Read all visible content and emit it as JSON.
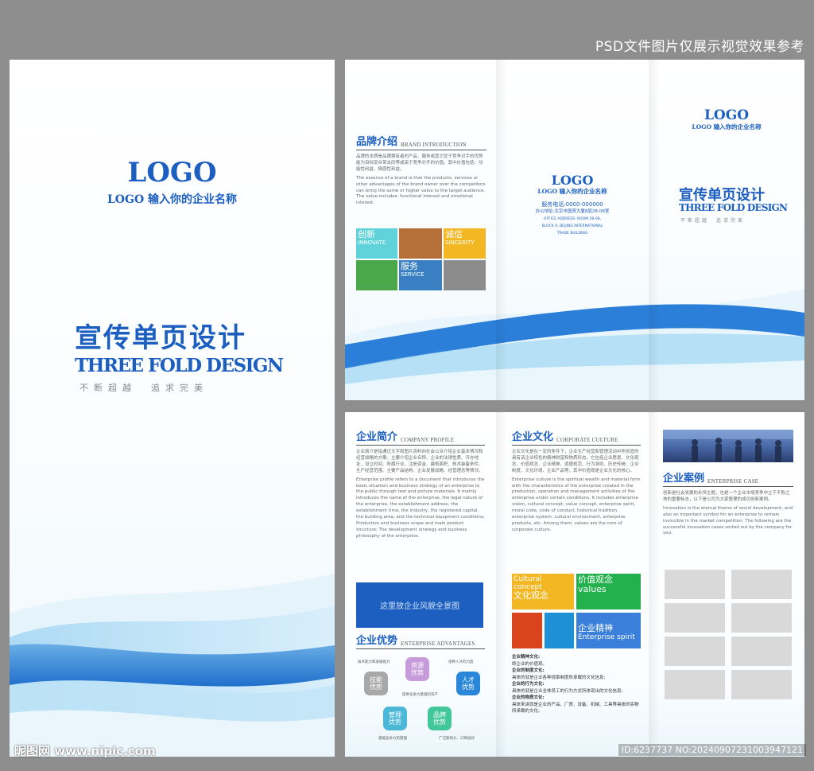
{
  "watermark_top": "PSD文件图片仅展示视觉效果参考",
  "watermark_bottom_left": "昵图网 www.nipic.com",
  "watermark_bottom_right": "ID:6237737 NO:20240907231003947121",
  "cover": {
    "logo": "LOGO",
    "company": "LOGO 输入你的企业名称",
    "title_cn": "宣传单页设计",
    "title_en": "THREE FOLD DESIGN",
    "slogan": "不断超越　追求完美"
  },
  "outside": {
    "brand": {
      "title_cn": "品牌介绍",
      "title_en": "BRAND INTRODUCTION",
      "text_cn": "品牌的本质是品牌拥有者的产品、服务或其它优于竞争对手的优势能为目标受众带去同等或高于竞争对手的价值。其中价值包括：功能性利益、情感性利益。",
      "text_en": "The essence of a brand is that the products, services or other advantages of the brand owner over the competitors can bring the same or higher value to the target audience. The value includes: functional interest and emotional interest.",
      "tiles": [
        {
          "cn": "创新",
          "en": "INNOVATE",
          "color": "#5fd3d9"
        },
        {
          "cn": "",
          "en": "",
          "color": "#b5703a"
        },
        {
          "cn": "诚信",
          "en": "SINCERITY",
          "color": "#f2b722"
        },
        {
          "cn": "",
          "en": "",
          "color": "#4aa84a"
        },
        {
          "cn": "服务",
          "en": "SERVICE",
          "color": "#3a7fc1"
        },
        {
          "cn": "",
          "en": "",
          "color": "#8c8c8c"
        }
      ]
    },
    "contact": {
      "logo": "LOGO",
      "company": "LOGO 输入你的企业名称",
      "phone": "服务电话:0000-000000",
      "address_cn": "办公地址:北京市国贸大厦8层28-08室",
      "address_en_1": "OFFICE ADDRESS: ROOM 28-08,",
      "address_en_2": "BLOCK A, BEIJING INTERNATIONAL",
      "address_en_3": "TRADE BUILDING"
    },
    "front": {
      "logo": "LOGO",
      "company": "LOGO 输入你的企业名称",
      "title_cn": "宣传单页设计",
      "title_en": "THREE FOLD DESIGN",
      "slogan": "不断超越　追求完美"
    }
  },
  "inside": {
    "profile": {
      "title_cn": "企业简介",
      "title_en": "COMPANY PROFILE",
      "text_cn": "企业简介是指通过文字和图片资料向社会公众介绍企业基本情况和经营战略的文案。主要介绍企业名称、企业的法律性质、开办地址、设立时间、所属行业、注册资金、建筑面积、技术装备条件、生产经营范围、主要产品结构、企业发展战略、经营理念等情况。",
      "text_en": "Enterprise profile refers to a document that introduces the basic situation and business strategy of an enterprise to the public through text and picture materials. It mainly introduces the name of the enterprise, the legal nature of the enterprise, the establishment address, the establishment time, the industry, the registered capital, the building area, and the technical equipment conditions; Production and business scope and main product structure; The development strategy and business philosophy of the enterprise.",
      "image_placeholder": "这里放企业风貌全景图"
    },
    "advantages": {
      "title_cn": "企业优势",
      "title_en": "ENTERPRISE ADVANTAGES",
      "hexes": [
        {
          "label": "技能\n优势",
          "color": "#a8a8a8"
        },
        {
          "label": "资源\n优势",
          "color": "#c79ad9"
        },
        {
          "label": "人才\n优势",
          "color": "#2a86d9"
        },
        {
          "label": "管理\n优势",
          "color": "#4ab8d6"
        },
        {
          "label": "品牌\n优势",
          "color": "#41c79a"
        }
      ],
      "notes": [
        "技术能力和发展能力",
        "培养人才的力度",
        "提供竞争力基础的资产",
        "基础竞争力的管理",
        "广泛影响力、口碑良好"
      ]
    },
    "culture": {
      "title_cn": "企业文化",
      "title_en": "CORPORATE CULTURE",
      "text_cn": "企业文化是在一定的条件下，企业生产经营和管理活动中所创造的具有该企业特色的精神财富和物质形态。它包括企业愿景、文化观念、价值观念、企业精神、道德规范、行为准则、历史传统、企业制度、文化环境、企业产品等，其中价值观是企业文化的核心。",
      "text_en": "Enterprise culture is the spiritual wealth and material form with the characteristics of the enterprise created in the production, operation and management activities of the enterprise under certain conditions. It includes enterprise vision, cultural concept, value concept, enterprise spirit, moral code, code of conduct, historical tradition, enterprise system, cultural environment, enterprise products, etc. Among them, values are the core of corporate culture.",
      "tiles": [
        {
          "top": "Cultural concept",
          "cn": "文化观念",
          "color": "#f2b722"
        },
        {
          "top": "价值观念",
          "cn": "values",
          "color": "#22b14c"
        },
        {
          "top": "",
          "cn": "",
          "color": "#d9441c"
        },
        {
          "top": "",
          "cn": "",
          "color": "#1e90d6"
        },
        {
          "top": "企业精神",
          "cn": "Enterprise spirit",
          "color": "#3a7fd9"
        }
      ],
      "list": [
        {
          "h": "企业精神文化:",
          "t": "即企业的价值观。"
        },
        {
          "h": "企业的制度文化:",
          "t": "具体的就是企业各种规章制度所承载的文化信息;"
        },
        {
          "h": "企业的行为文化:",
          "t": "具体的就是企业全体员工的行为方式所体现出的文化信息;"
        },
        {
          "h": "企业的物质文化:",
          "t": "具体来讲就是企业的产品、厂房、设备、机械、工具等具体的实物所承载的文化。"
        }
      ]
    },
    "cases": {
      "title_cn": "企业案例",
      "title_en": "ENTERPRISE CASE",
      "text_cn": "创新是社会发展的永恒主题，也是一个企业市场竞争中立于不败之地的重要标志，以下是公司为大家整理的成功创新案例。",
      "text_en": "Innovation is the eternal theme of social development, and also an important symbol for an enterprise to remain invincible in the market competition. The following are the successful innovation cases sorted out by the company for you."
    }
  }
}
